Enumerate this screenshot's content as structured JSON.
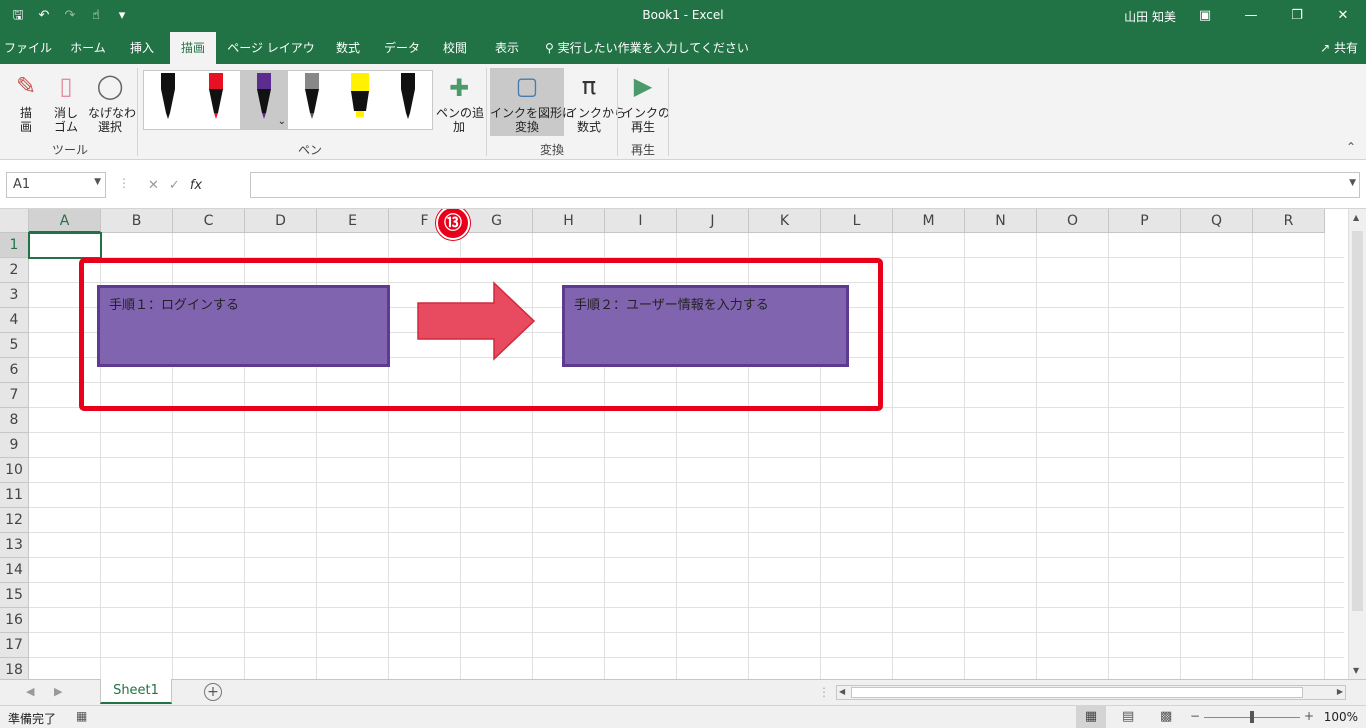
{
  "titlebar": {
    "title": "Book1  -  Excel",
    "user": "山田 知美",
    "qat": [
      "save-icon",
      "undo-icon",
      "redo-icon",
      "touch-mode-icon",
      "customize-icon"
    ]
  },
  "tabs": {
    "items": [
      "ファイル",
      "ホーム",
      "挿入",
      "描画",
      "ページ レイアウト",
      "数式",
      "データ",
      "校閲",
      "表示"
    ],
    "active": "描画",
    "tellme": "実行したい作業を入力してください",
    "share": "共有"
  },
  "ribbon": {
    "tools": {
      "draw": "描\n画",
      "erase": "消し\nゴム",
      "lasso": "なげなわ\n選択",
      "group": "ツール"
    },
    "pens": {
      "add_pen": "ペンの追\n加",
      "group": "ペン",
      "colors": [
        "#111111",
        "#e81123",
        "#5c2d91",
        "#888888",
        "#fff100",
        "#111111"
      ]
    },
    "convert": {
      "ink_to_shape": "インクを図形に\n変換",
      "ink_to_math": "インクから\n数式",
      "group": "変換"
    },
    "replay": {
      "ink_replay": "インクの\n再生",
      "group": "再生"
    }
  },
  "formula_bar": {
    "name_box": "A1",
    "fx": "fx",
    "value": ""
  },
  "grid": {
    "columns": [
      "A",
      "B",
      "C",
      "D",
      "E",
      "F",
      "G",
      "H",
      "I",
      "J",
      "K",
      "L",
      "M",
      "N",
      "O",
      "P",
      "Q",
      "R"
    ],
    "rows": [
      "1",
      "2",
      "3",
      "4",
      "5",
      "6",
      "7",
      "8",
      "9",
      "10",
      "11",
      "12",
      "13",
      "14",
      "15",
      "16",
      "17",
      "18"
    ],
    "active_cell": "A1"
  },
  "shapes": {
    "step1": "手順１：ログインする",
    "step2": "手順２：ユーザー情報を入力する",
    "fill": "#8064af",
    "arrow_color": "#e84a5f"
  },
  "annotation": {
    "step_number": "⑬",
    "color": "#e8001b"
  },
  "sheets": {
    "tabs": [
      "Sheet1"
    ],
    "active": "Sheet1"
  },
  "status": {
    "ready": "準備完了",
    "zoom": "100%"
  }
}
